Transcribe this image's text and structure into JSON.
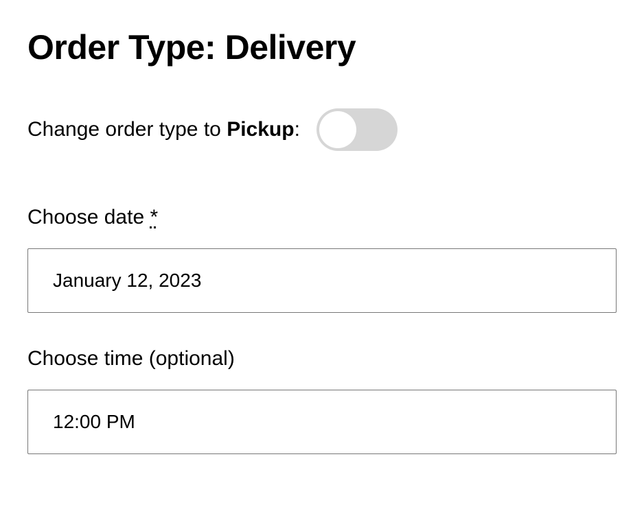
{
  "header": {
    "title_prefix": "Order Type: ",
    "title_value": "Delivery"
  },
  "toggle": {
    "label_prefix": "Change order type to ",
    "label_bold": "Pickup",
    "label_suffix": ":",
    "checked": false
  },
  "date_field": {
    "label": "Choose date ",
    "required_mark": "*",
    "value": "January 12, 2023"
  },
  "time_field": {
    "label": "Choose time (optional)",
    "value": "12:00 PM"
  }
}
